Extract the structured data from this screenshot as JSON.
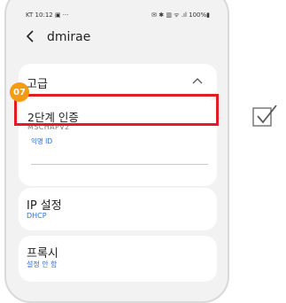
{
  "status_bar": {
    "time": "KT 10:12",
    "left_icons": "▣ ···",
    "right_icons": "✉ ✱ ▥ ᯤ .ıl 100%▮"
  },
  "header": {
    "back_icon": "chevron-left",
    "title": "dmirae"
  },
  "advanced": {
    "label": "고급",
    "chevron": "^"
  },
  "step_badge": "07",
  "auth": {
    "title": "2단계 인증",
    "value": "MSCHAPV2"
  },
  "anonymous_id": {
    "label": "익명 ID",
    "value": ""
  },
  "ip_settings": {
    "title": "IP 설정",
    "value": "DHCP"
  },
  "proxy": {
    "title": "프록시",
    "value": "설정 안 함"
  },
  "colors": {
    "highlight": "#e31b23",
    "badge": "#f39c12",
    "link_blue": "#2a6fd6"
  }
}
